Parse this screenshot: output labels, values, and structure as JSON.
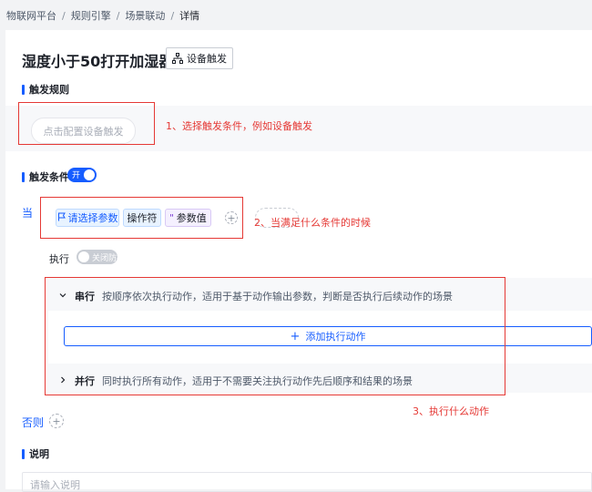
{
  "breadcrumb": [
    "物联网平台",
    "规则引擎",
    "场景联动",
    "详情"
  ],
  "breadcrumb_separator": "/",
  "header": {
    "title": "湿度小于50打开加湿器",
    "trigger_type_label": "设备触发",
    "trigger_type_icon": "hierarchy-icon"
  },
  "trigger_rule": {
    "title": "触发规则",
    "config_button_label": "点击配置设备触发",
    "annotation": "1、选择触发条件，例如设备触发"
  },
  "condition": {
    "title": "触发条件",
    "switch_label": "开",
    "switch_on": true,
    "when_label": "当",
    "param_chip_label": "请选择参数",
    "param_chip_icon": "flag-icon",
    "operator_chip_label": "操作符",
    "value_chip_label": "参数值",
    "value_chip_prefix": "\"",
    "annotation": "2、当满足什么条件的时候"
  },
  "execution": {
    "label": "执行",
    "shake_switch_label": "关闭防抖",
    "shake_switch_on": false,
    "serial": {
      "name": "串行",
      "description": "按顺序依次执行动作，适用于基于动作输出参数，判断是否执行后续动作的场景",
      "expanded": true,
      "add_button_label": "添加执行动作",
      "add_button_prefix": "+"
    },
    "parallel": {
      "name": "并行",
      "description": "同时执行所有动作，适用于不需要关注执行动作先后顺序和结果的场景",
      "expanded": false
    },
    "annotation": "3、执行什么动作"
  },
  "else_label": "否则",
  "description_section": {
    "title": "说明",
    "placeholder": "请输入说明"
  },
  "colors": {
    "accent": "#165dff",
    "annotation_red": "#e53935",
    "background": "#f2f3f5"
  }
}
